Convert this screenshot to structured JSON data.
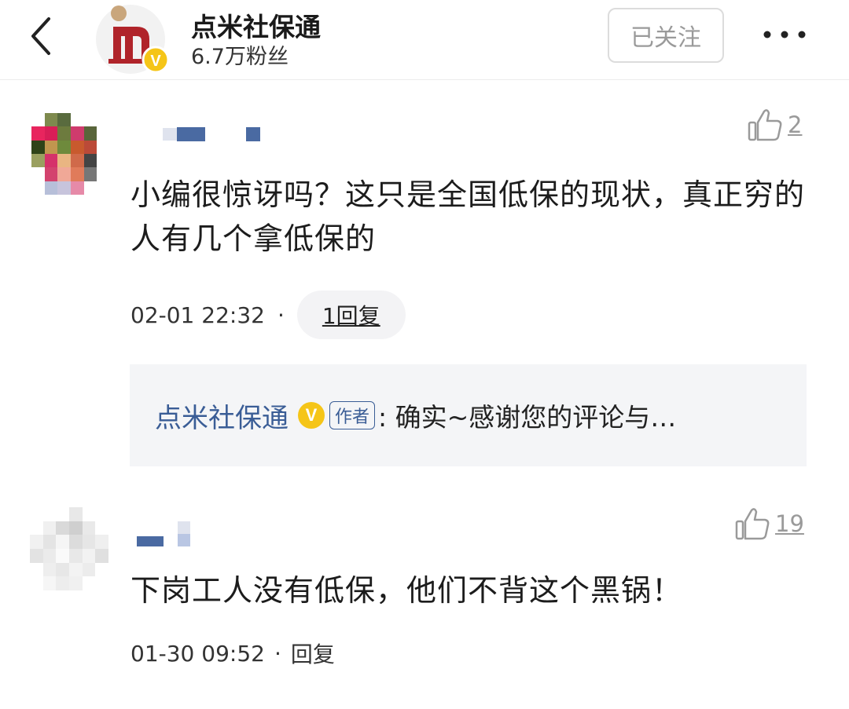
{
  "header": {
    "channel_name": "点米社保通",
    "fans": "6.7万粉丝",
    "follow_label": "已关注",
    "verified_badge": "V",
    "icons": [
      "back-icon",
      "more-icon"
    ]
  },
  "colors": {
    "link_blue": "#3a5d96",
    "verified_yellow": "#f5c518",
    "logo_red": "#b0242a",
    "muted_gray": "#9a9a9a"
  },
  "comments": [
    {
      "like_count": "2",
      "text": "小编很惊讶吗？这只是全国低保的现状，真正穷的人有几个拿低保的",
      "time": "02-01 22:32",
      "separator": "·",
      "reply_label": "1回复",
      "reply_preview": {
        "author": "点米社保通",
        "badge": "V",
        "tag": "作者",
        "text": ": 确实~感谢您的评论与…"
      }
    },
    {
      "like_count": "19",
      "text": "下岗工人没有低保，他们不背这个黑锅！",
      "time": "01-30 09:52",
      "separator": "·",
      "reply_label": "回复"
    }
  ]
}
